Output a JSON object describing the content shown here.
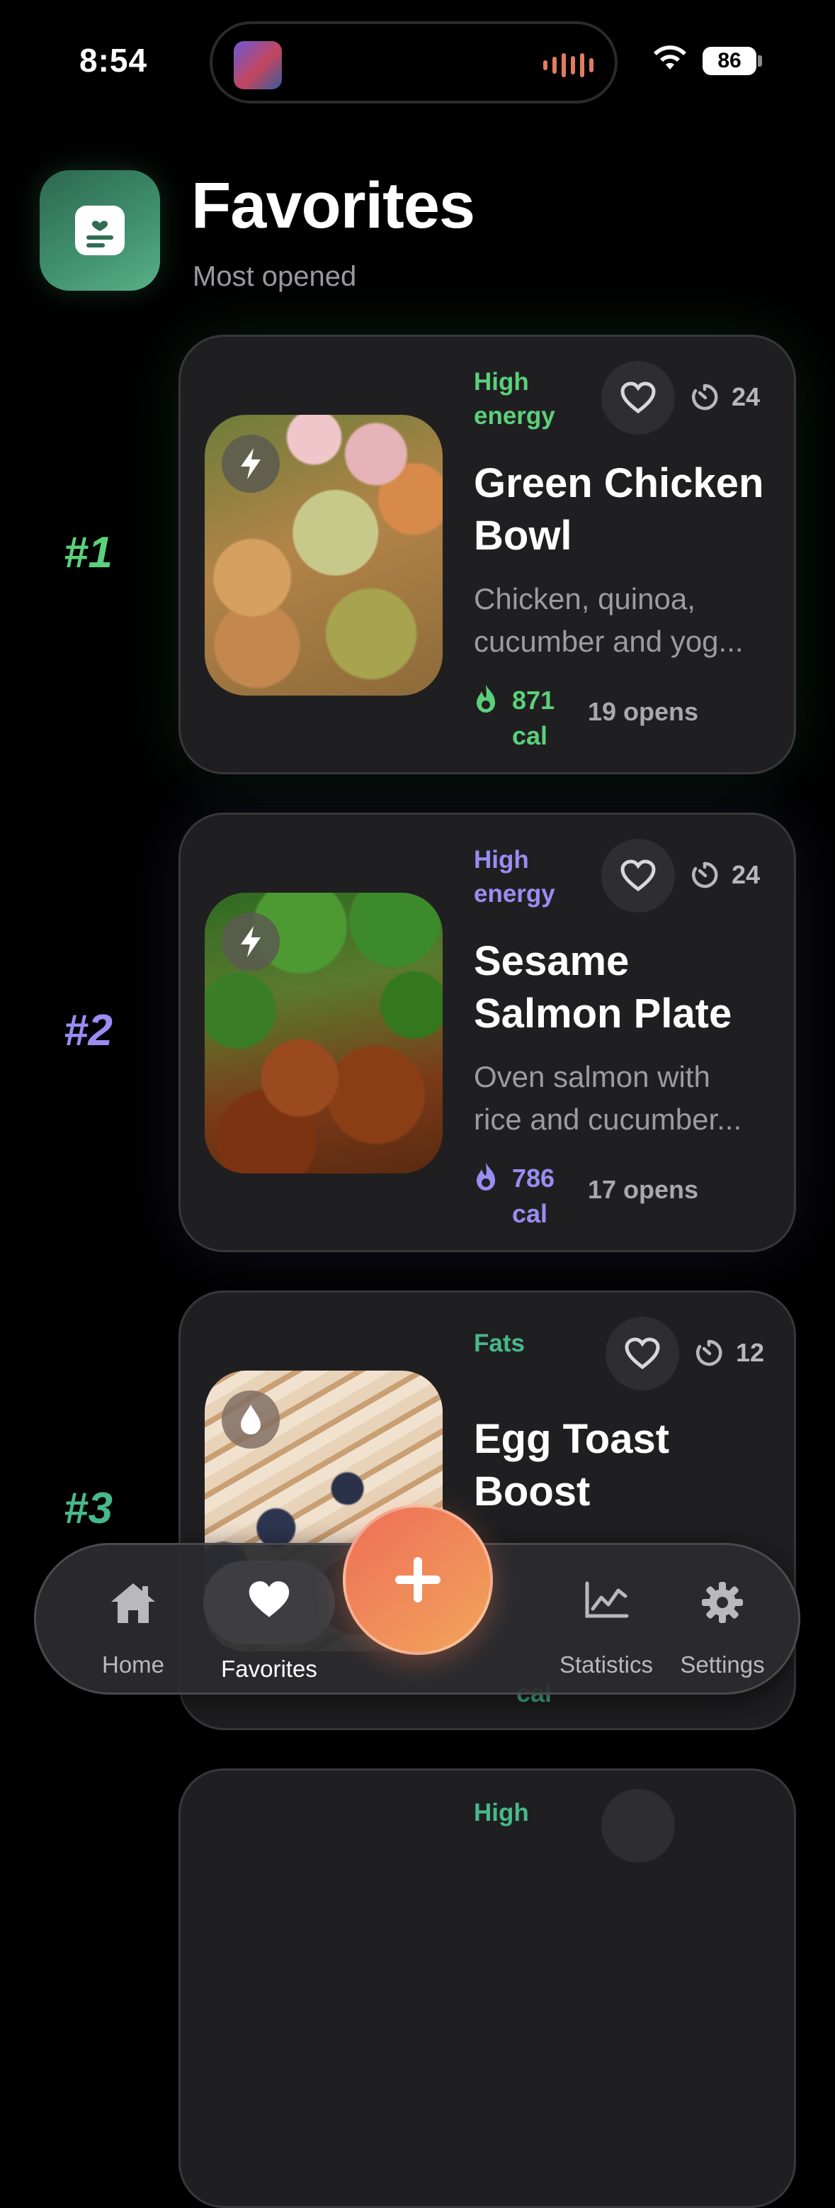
{
  "status_bar": {
    "time": "8:54",
    "battery": "86"
  },
  "header": {
    "title": "Favorites",
    "subtitle": "Most opened"
  },
  "colors": {
    "green": "#5bd07a",
    "purple": "#9b8cf2",
    "teal": "#48b88a",
    "accent": "#f08a5d"
  },
  "cards": [
    {
      "rank": "#1",
      "tag": "High energy",
      "time": "24",
      "name": "Green Chicken Bowl",
      "desc_line1": "Chicken, quinoa,",
      "desc_line2": "cucumber and yog...",
      "cal_value": "871",
      "cal_unit": "cal",
      "opens": "19 opens",
      "badge_icon": "bolt-icon"
    },
    {
      "rank": "#2",
      "tag": "High energy",
      "time": "24",
      "name": "Sesame Salmon Plate",
      "desc_line1": "Oven salmon with",
      "desc_line2": "rice and cucumber...",
      "cal_value": "786",
      "cal_unit": "cal",
      "opens": "17 opens",
      "badge_icon": "bolt-icon"
    },
    {
      "rank": "#3",
      "tag": "Fats",
      "time": "12",
      "name": "Egg Toast Boost",
      "cal_unit": "cal",
      "badge_icon": "drop-icon"
    },
    {
      "tag": "High"
    }
  ],
  "tabs": [
    {
      "label": "Home",
      "icon": "home-icon"
    },
    {
      "label": "Favorites",
      "icon": "heart-icon",
      "active": true
    },
    {
      "label": "Statistics",
      "icon": "chart-icon"
    },
    {
      "label": "Settings",
      "icon": "gear-icon"
    }
  ]
}
